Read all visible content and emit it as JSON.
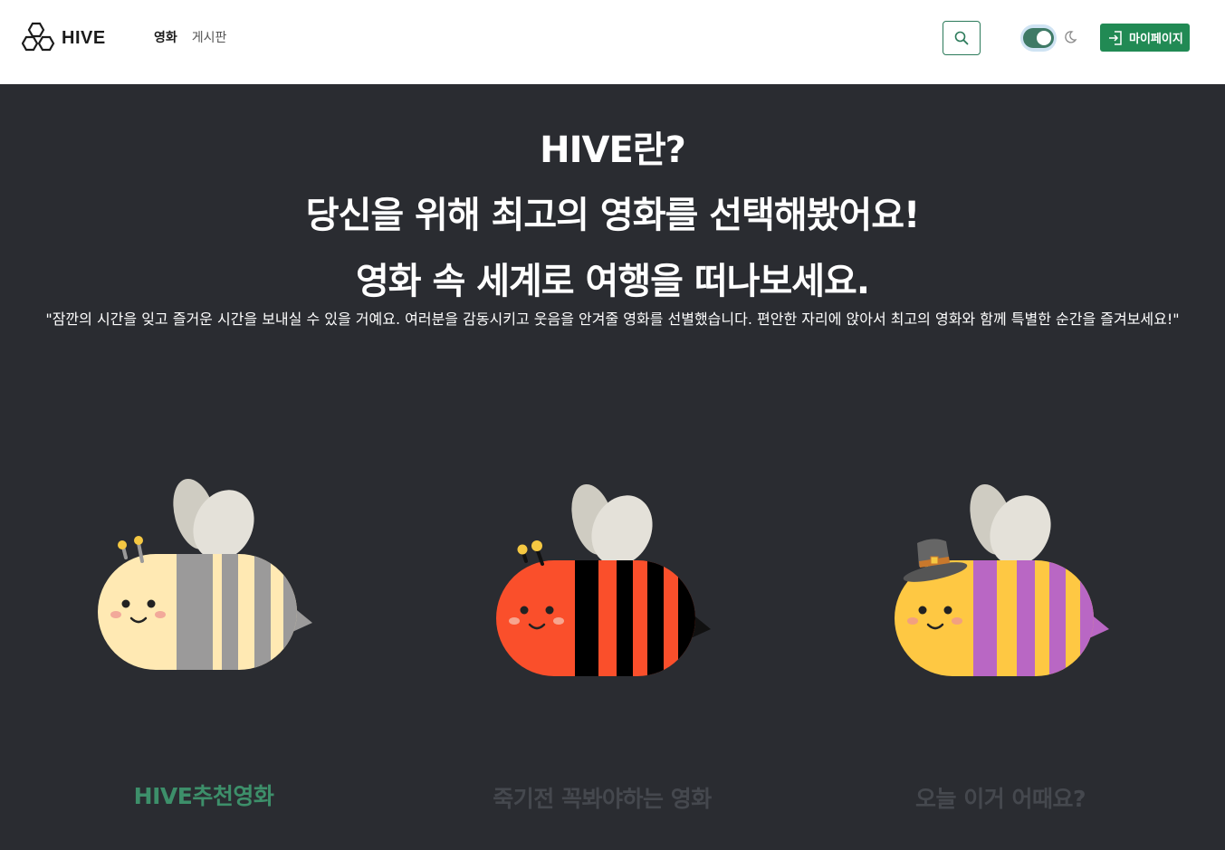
{
  "nav": {
    "brand": "HIVE",
    "links": [
      "영화",
      "게시판"
    ],
    "mypage_label": "마이페이지"
  },
  "hero": {
    "line1": "HIVE란?",
    "line2": "당신을 위해 최고의 영화를 선택해봤어요!",
    "line3": "영화 속 세계로 여행을 떠나보세요.",
    "description": "\"잠깐의 시간을 잊고 즐거운 시간을 보내실 수 있을 거예요. 여러분을 감동시키고 웃음을 안겨줄 영화를 선별했습니다. 편안한 자리에 앉아서 최고의 영화와 함께 특별한 순간을 즐겨보세요!\""
  },
  "cards": [
    {
      "label": "HIVE추천영화",
      "color": "#3d8f6a",
      "active": true
    },
    {
      "label": "죽기전 꼭봐야하는 영화",
      "color": "#45484e",
      "active": false
    },
    {
      "label": "오늘 이거 어때요?",
      "color": "#45484e",
      "active": false
    }
  ],
  "colors": {
    "accent": "#218a54",
    "background": "#2a2c31"
  }
}
